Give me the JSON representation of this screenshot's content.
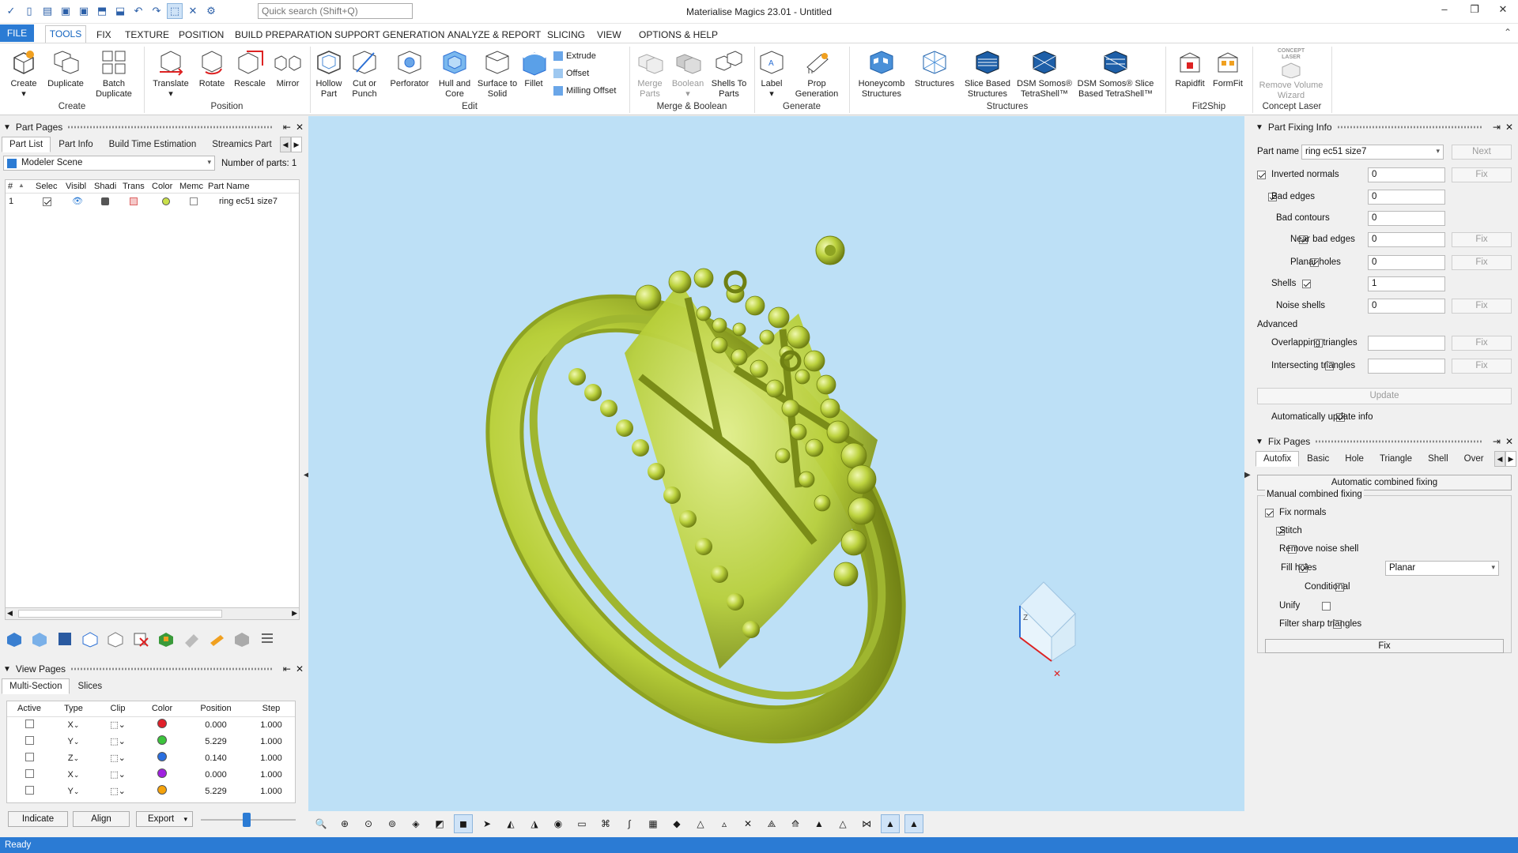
{
  "app": {
    "title": "Materialise Magics 23.01 - Untitled",
    "status": "Ready"
  },
  "quick_search": {
    "placeholder": "Quick search (Shift+Q)"
  },
  "menu": [
    "FILE",
    "TOOLS",
    "FIX",
    "TEXTURE",
    "POSITION",
    "BUILD PREPARATION",
    "SUPPORT GENERATION",
    "ANALYZE & REPORT",
    "SLICING",
    "VIEW",
    "OPTIONS & HELP"
  ],
  "ribbon": {
    "groups": {
      "create": "Create",
      "position": "Position",
      "edit": "Edit",
      "merge": "Merge & Boolean",
      "generate": "Generate",
      "structures": "Structures",
      "fit2ship": "Fit2Ship",
      "concept": "Concept Laser"
    },
    "create": {
      "create": "Create",
      "duplicate": "Duplicate",
      "batch1": "Batch",
      "batch2": "Duplicate"
    },
    "position": {
      "translate": "Translate",
      "rotate": "Rotate",
      "rescale": "Rescale",
      "mirror": "Mirror"
    },
    "edit": {
      "hollow1": "Hollow",
      "hollow2": "Part",
      "cut1": "Cut or",
      "cut2": "Punch",
      "perforator": "Perforator",
      "hull1": "Hull and",
      "hull2": "Core",
      "surface1": "Surface to",
      "surface2": "Solid",
      "fillet": "Fillet",
      "extrude": "Extrude",
      "offset": "Offset",
      "milling": "Milling Offset"
    },
    "merge": {
      "merge1": "Merge",
      "merge2": "Parts",
      "boolean": "Boolean",
      "shells1": "Shells To",
      "shells2": "Parts"
    },
    "generate": {
      "label": "Label",
      "prop1": "Prop",
      "prop2": "Generation"
    },
    "structures": {
      "honey1": "Honeycomb",
      "honey2": "Structures",
      "structures": "Structures",
      "slice1": "Slice Based",
      "slice2": "Structures",
      "dsm1a": "DSM Somos®",
      "dsm1b": "TetraShell™",
      "dsm2a": "DSM Somos® Slice",
      "dsm2b": "Based TetraShell™"
    },
    "fit2ship": {
      "rapidfit": "Rapidfit",
      "formfit": "FormFit"
    },
    "concept": {
      "logo1": "CONCEPT",
      "logo2": "LASER",
      "remove1": "Remove Volume",
      "remove2": "Wizard"
    }
  },
  "part_pages": {
    "title": "Part Pages",
    "tabs": [
      "Part List",
      "Part Info",
      "Build Time Estimation",
      "Streamics Part"
    ],
    "scene": "Modeler Scene",
    "count_label": "Number of parts:",
    "count": "1",
    "columns": [
      "#",
      "Selec",
      "Visibl",
      "Shadi",
      "Trans",
      "Color",
      "Memc",
      "Part Name"
    ],
    "rows": [
      {
        "num": "1",
        "name": "ring ec51 size7",
        "color": "#c9e04a"
      }
    ]
  },
  "view_pages": {
    "title": "View Pages",
    "tabs": [
      "Multi-Section",
      "Slices"
    ],
    "columns": [
      "Active",
      "Type",
      "Clip",
      "Color",
      "Position",
      "Step"
    ],
    "rows": [
      {
        "type": "X",
        "color": "#e0202a",
        "position": "0.000",
        "step": "1.000"
      },
      {
        "type": "Y",
        "color": "#3cc43c",
        "position": "5.229",
        "step": "1.000"
      },
      {
        "type": "Z",
        "color": "#2a6fe0",
        "position": "0.140",
        "step": "1.000"
      },
      {
        "type": "X",
        "color": "#a020e0",
        "position": "0.000",
        "step": "1.000"
      },
      {
        "type": "Y",
        "color": "#f5a20a",
        "position": "5.229",
        "step": "1.000"
      }
    ],
    "indicate": "Indicate",
    "align": "Align",
    "export": "Export"
  },
  "part_fixing": {
    "title": "Part Fixing Info",
    "part_name_label": "Part name",
    "part_name": "ring ec51 size7",
    "next": "Next",
    "rows": [
      {
        "label": "Inverted normals",
        "value": "0",
        "checked": true
      },
      {
        "label": "Bad edges",
        "value": "0",
        "checked": true
      },
      {
        "label": "Bad contours",
        "value": "0"
      },
      {
        "label": "Near bad edges",
        "value": "0",
        "checked": true
      },
      {
        "label": "Planar holes",
        "value": "0",
        "checked": true
      },
      {
        "label": "Shells",
        "value": "1",
        "checked": true
      },
      {
        "label": "Noise shells",
        "value": "0"
      },
      {
        "label": "Overlapping triangles",
        "value": ""
      },
      {
        "label": "Intersecting triangles",
        "value": ""
      }
    ],
    "advanced": "Advanced",
    "fix": "Fix",
    "update": "Update",
    "auto_update": "Automatically update info"
  },
  "fix_pages": {
    "title": "Fix Pages",
    "tabs": [
      "Autofix",
      "Basic",
      "Hole",
      "Triangle",
      "Shell",
      "Over"
    ],
    "auto_btn": "Automatic combined fixing",
    "manual": "Manual combined fixing",
    "options": {
      "normals": "Fix normals",
      "stitch": "Stitch",
      "noise": "Remove noise shell",
      "fill": "Fill holes",
      "conditional": "Conditional",
      "unify": "Unify",
      "filter": "Filter sharp triangles"
    },
    "fill_mode": "Planar",
    "fix": "Fix"
  },
  "axis": {
    "z": "Z"
  },
  "colors": {
    "accent": "#2b7bd4",
    "viewport": "#bde0f6",
    "part": "#c9e04a"
  }
}
